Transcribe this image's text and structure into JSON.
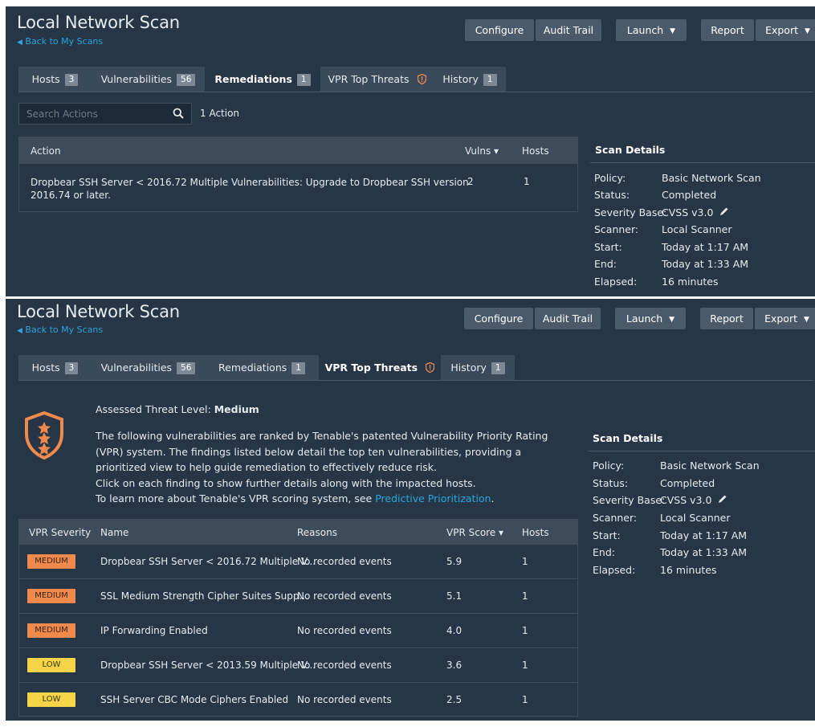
{
  "colors": {
    "panel_bg": "#263646",
    "link": "#29a6de",
    "sev_medium": "#ef8a4c",
    "sev_low": "#f5d547"
  },
  "top": {
    "title": "Local Network Scan",
    "back": "Back to My Scans",
    "toolbar": {
      "configure": "Configure",
      "audit": "Audit Trail",
      "launch": "Launch",
      "report": "Report",
      "export": "Export"
    },
    "tabs": [
      {
        "label": "Hosts",
        "badge": "3"
      },
      {
        "label": "Vulnerabilities",
        "badge": "56"
      },
      {
        "label": "Remediations",
        "badge": "1"
      },
      {
        "label": "VPR Top Threats",
        "badge": ""
      },
      {
        "label": "History",
        "badge": "1"
      }
    ],
    "search_placeholder": "Search Actions",
    "action_count": "1 Action",
    "table": {
      "headers": [
        "Action",
        "Vulns ▾",
        "Hosts"
      ],
      "rows": [
        {
          "action_line1": "Dropbear SSH Server < 2016.72 Multiple Vulnerabilities: Upgrade to Dropbear SSH version",
          "action_line2": "2016.74 or later.",
          "vulns": "2",
          "hosts": "1"
        }
      ]
    },
    "details": {
      "title": "Scan Details",
      "items": [
        {
          "label": "Policy:",
          "value": "Basic Network Scan"
        },
        {
          "label": "Status:",
          "value": "Completed"
        },
        {
          "label": "Severity Base:",
          "value": "CVSS v3.0"
        },
        {
          "label": "Scanner:",
          "value": "Local Scanner"
        },
        {
          "label": "Start:",
          "value": "Today at 1:17 AM"
        },
        {
          "label": "End:",
          "value": "Today at 1:33 AM"
        },
        {
          "label": "Elapsed:",
          "value": "16 minutes"
        }
      ]
    }
  },
  "bottom": {
    "title": "Local Network Scan",
    "back": "Back to My Scans",
    "toolbar": {
      "configure": "Configure",
      "audit": "Audit Trail",
      "launch": "Launch",
      "report": "Report",
      "export": "Export"
    },
    "tabs": [
      {
        "label": "Hosts",
        "badge": "3"
      },
      {
        "label": "Vulnerabilities",
        "badge": "56"
      },
      {
        "label": "Remediations",
        "badge": "1"
      },
      {
        "label": "VPR Top Threats",
        "badge": ""
      },
      {
        "label": "History",
        "badge": "1"
      }
    ],
    "vpr": {
      "level_label": "Assessed Threat Level: ",
      "level_value": "Medium",
      "lines": [
        "The following vulnerabilities are ranked by Tenable's patented Vulnerability Priority Rating",
        "(VPR) system. The findings listed below detail the top ten vulnerabilities, providing a",
        "prioritized view to help guide remediation to effectively reduce risk.",
        "Click on each finding to show further details along with the impacted hosts."
      ],
      "learn_prefix": "To learn more about Tenable's VPR scoring system, see ",
      "learn_link": "Predictive Prioritization",
      "learn_suffix": "."
    },
    "table": {
      "headers": [
        "VPR Severity",
        "Name",
        "Reasons",
        "VPR Score ▾",
        "Hosts"
      ],
      "rows": [
        {
          "severity": "MEDIUM",
          "name": "Dropbear SSH Server < 2016.72 Multiple V...",
          "reasons": "No recorded events",
          "score": "5.9",
          "hosts": "1"
        },
        {
          "severity": "MEDIUM",
          "name": "SSL Medium Strength Cipher Suites Supp...",
          "reasons": "No recorded events",
          "score": "5.1",
          "hosts": "1"
        },
        {
          "severity": "MEDIUM",
          "name": "IP Forwarding Enabled",
          "reasons": "No recorded events",
          "score": "4.0",
          "hosts": "1"
        },
        {
          "severity": "LOW",
          "name": "Dropbear SSH Server < 2013.59 Multiple V...",
          "reasons": "No recorded events",
          "score": "3.6",
          "hosts": "1"
        },
        {
          "severity": "LOW",
          "name": "SSH Server CBC Mode Ciphers Enabled",
          "reasons": "No recorded events",
          "score": "2.5",
          "hosts": "1"
        }
      ]
    },
    "details": {
      "title": "Scan Details",
      "items": [
        {
          "label": "Policy:",
          "value": "Basic Network Scan"
        },
        {
          "label": "Status:",
          "value": "Completed"
        },
        {
          "label": "Severity Base:",
          "value": "CVSS v3.0"
        },
        {
          "label": "Scanner:",
          "value": "Local Scanner"
        },
        {
          "label": "Start:",
          "value": "Today at 1:17 AM"
        },
        {
          "label": "End:",
          "value": "Today at 1:33 AM"
        },
        {
          "label": "Elapsed:",
          "value": "16 minutes"
        }
      ]
    }
  }
}
